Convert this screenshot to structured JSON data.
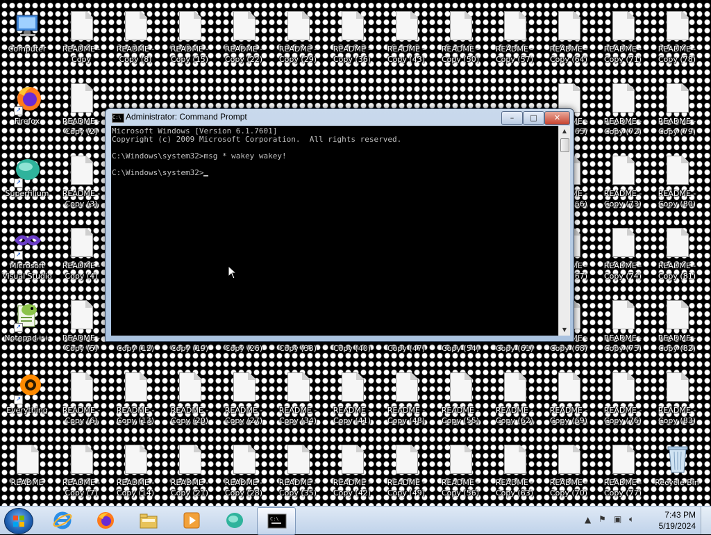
{
  "desktop": {
    "shortcuts": [
      {
        "label": "Computer",
        "icon": "computer-icon"
      },
      {
        "label": "Firefox",
        "icon": "firefox-icon"
      },
      {
        "label": "Superfilium",
        "icon": "superfilium-icon"
      },
      {
        "label": "Microsoft\nVisual Studio",
        "icon": "visual-studio-icon"
      },
      {
        "label": "Notepad++",
        "icon": "notepad-plus-plus-icon"
      },
      {
        "label": "Everything",
        "icon": "everything-icon"
      }
    ],
    "file_rows": [
      [
        "README -\nCopy",
        "README -\nCopy (8)",
        "README -\nCopy (15)",
        "README -\nCopy (22)",
        "README -\nCopy (29)",
        "README -\nCopy (36)",
        "README -\nCopy (43)",
        "README -\nCopy (50)",
        "README -\nCopy (57)",
        "README -\nCopy (64)",
        "README -\nCopy (71)",
        "README -\nCopy (78)"
      ],
      [
        "README -\nCopy (2)",
        "",
        "",
        "",
        "",
        "",
        "",
        "",
        "",
        "README -\nCopy (65)",
        "README -\nCopy (72)",
        "README -\nCopy (79)"
      ],
      [
        "README -\nCopy (3)",
        "",
        "",
        "",
        "",
        "",
        "",
        "",
        "",
        "README -\nCopy (66)",
        "README -\nCopy (73)",
        "README -\nCopy (80)"
      ],
      [
        "README -\nCopy (4)",
        "",
        "",
        "",
        "",
        "",
        "",
        "",
        "",
        "README -\nCopy (67)",
        "README -\nCopy (74)",
        "README -\nCopy (81)"
      ],
      [
        "README -\nCopy (5)",
        "README -\nCopy (12)",
        "README -\nCopy (19)",
        "README -\nCopy (26)",
        "README -\nCopy (33)",
        "README -\nCopy (40)",
        "README -\nCopy (47)",
        "README -\nCopy (54)",
        "README -\nCopy (61)",
        "README -\nCopy (68)",
        "README -\nCopy (75)",
        "README -\nCopy (82)"
      ],
      [
        "README -\nCopy (6)",
        "README -\nCopy (13)",
        "README -\nCopy (20)",
        "README -\nCopy (27)",
        "README -\nCopy (34)",
        "README -\nCopy (41)",
        "README -\nCopy (48)",
        "README -\nCopy (55)",
        "README -\nCopy (62)",
        "README -\nCopy (69)",
        "README -\nCopy (76)",
        "README -\nCopy (83)"
      ],
      [
        "README",
        "README -\nCopy (7)",
        "README -\nCopy (14)",
        "README -\nCopy (21)",
        "README -\nCopy (28)",
        "README -\nCopy (35)",
        "README -\nCopy (42)",
        "README -\nCopy (49)",
        "README -\nCopy (56)",
        "README -\nCopy (63)",
        "README -\nCopy (70)",
        "README -\nCopy (77)"
      ]
    ],
    "recycle_bin_label": "Recycle Bin"
  },
  "cmd_window": {
    "title": "Administrator: Command Prompt",
    "title_icon_text": "C:\\",
    "lines": [
      "Microsoft Windows [Version 6.1.7601]",
      "Copyright (c) 2009 Microsoft Corporation.  All rights reserved.",
      "",
      "C:\\Windows\\system32>msg * wakey wakey!",
      "",
      "C:\\Windows\\system32>"
    ],
    "buttons": {
      "minimize": "–",
      "maximize": "□",
      "close": "✕"
    }
  },
  "taskbar": {
    "pinned": [
      {
        "name": "internet-explorer-icon"
      },
      {
        "name": "firefox-icon"
      },
      {
        "name": "explorer-icon"
      },
      {
        "name": "media-player-icon"
      },
      {
        "name": "superfilium-icon"
      },
      {
        "name": "command-prompt-icon"
      }
    ],
    "clock_time": "7:43 PM",
    "clock_date": "5/19/2024"
  },
  "colors": {
    "console_bg": "#000000",
    "console_text": "#c0c0c0",
    "taskbar": "#cfdcee"
  }
}
